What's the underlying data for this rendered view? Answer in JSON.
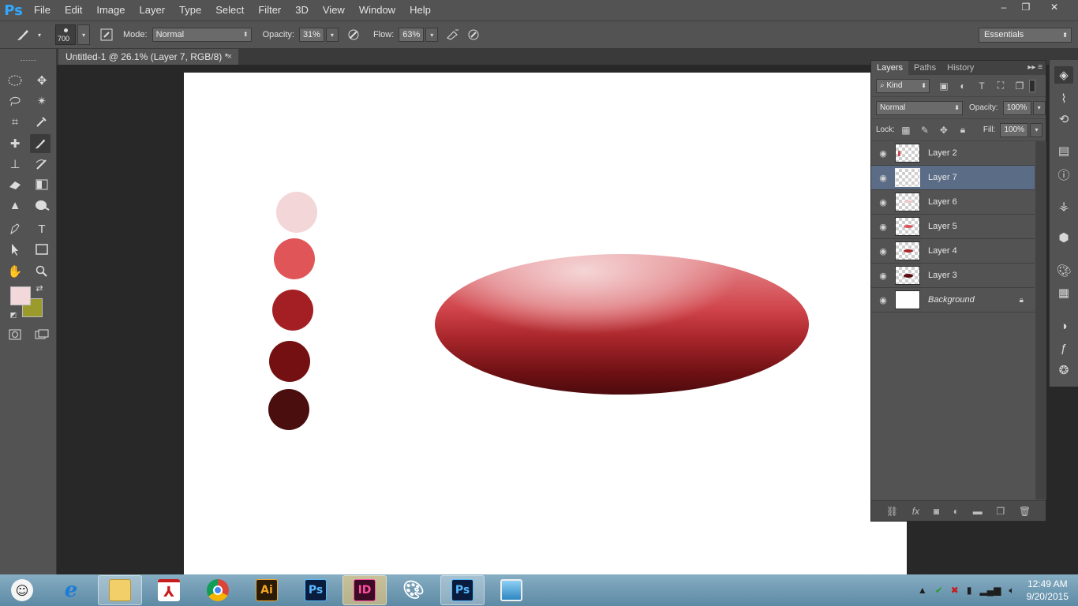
{
  "app": {
    "logo": "Ps"
  },
  "menu": [
    "File",
    "Edit",
    "Image",
    "Layer",
    "Type",
    "Select",
    "Filter",
    "3D",
    "View",
    "Window",
    "Help"
  ],
  "window_controls": {
    "minimize": "–",
    "restore": "❐",
    "close": "✕"
  },
  "options": {
    "brush_size": "700",
    "mode_label": "Mode:",
    "mode_value": "Normal",
    "opacity_label": "Opacity:",
    "opacity_value": "31%",
    "flow_label": "Flow:",
    "flow_value": "63%"
  },
  "workspace": "Essentials",
  "document_tab": {
    "title": "Untitled-1 @ 26.1% (Layer 7, RGB/8) *",
    "close": "×"
  },
  "colors": {
    "foreground": "#f2d8da",
    "background": "#9b9b2c",
    "swatches": [
      "#f3d6d8",
      "#e05558",
      "#a41f24",
      "#741012",
      "#4a0e0f"
    ]
  },
  "layers_panel": {
    "tabs": [
      "Layers",
      "Paths",
      "History"
    ],
    "filter_label": "Kind",
    "blend_mode": "Normal",
    "opacity_label": "Opacity:",
    "opacity_value": "100%",
    "lock_label": "Lock:",
    "fill_label": "Fill:",
    "fill_value": "100%",
    "layers": [
      {
        "name": "Layer 2",
        "visible": true,
        "selected": false
      },
      {
        "name": "Layer 7",
        "visible": true,
        "selected": true
      },
      {
        "name": "Layer 6",
        "visible": true,
        "selected": false
      },
      {
        "name": "Layer 5",
        "visible": true,
        "selected": false
      },
      {
        "name": "Layer 4",
        "visible": true,
        "selected": false
      },
      {
        "name": "Layer 3",
        "visible": true,
        "selected": false
      },
      {
        "name": "Background",
        "visible": true,
        "selected": false,
        "locked": true
      }
    ]
  },
  "taskbar": {
    "apps": [
      "anonymous-mask",
      "internet-explorer",
      "file-explorer",
      "acrobat",
      "chrome",
      "illustrator",
      "photoshop",
      "indesign",
      "paint",
      "photoshop-active",
      "photo-viewer"
    ],
    "illustrator_label": "Ai",
    "photoshop_label": "Ps",
    "indesign_label": "ID",
    "time": "12:49 AM",
    "date": "9/20/2015"
  }
}
